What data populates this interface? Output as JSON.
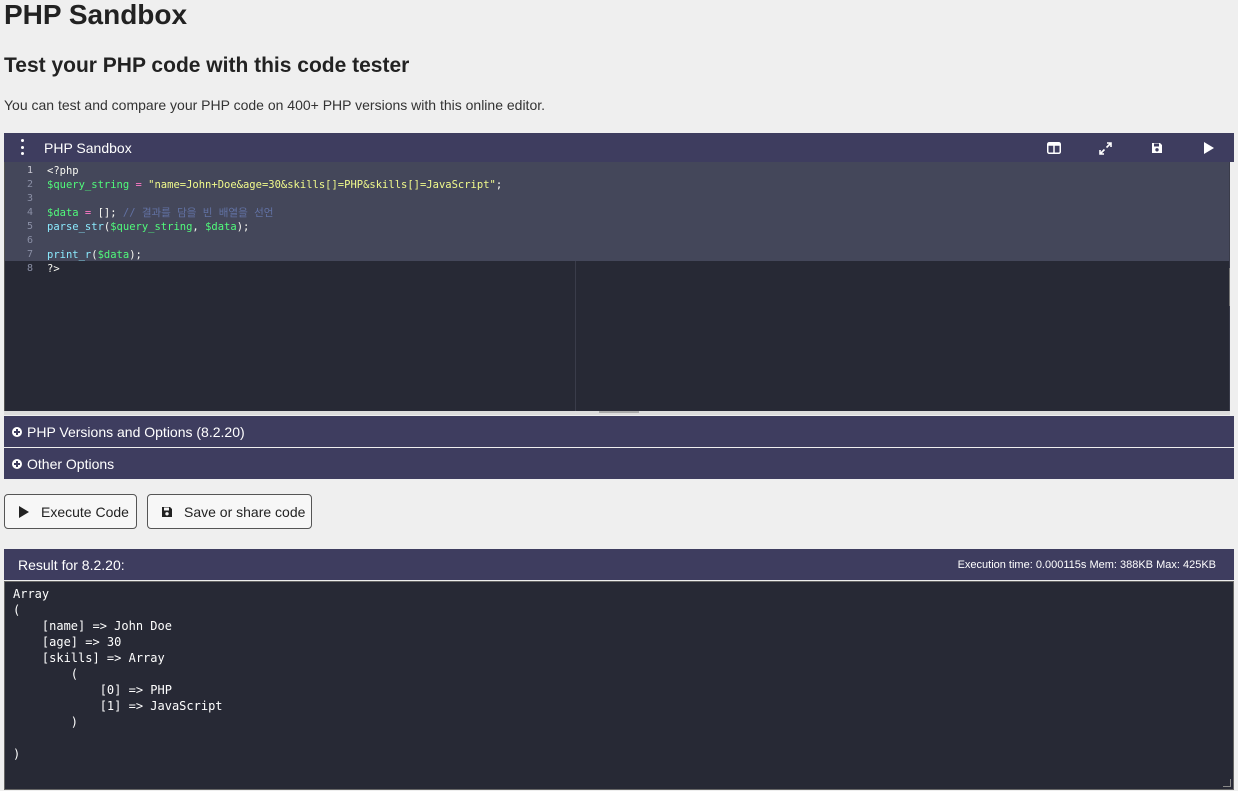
{
  "page": {
    "title": "PHP Sandbox",
    "subtitle": "Test your PHP code with this code tester",
    "description": "You can test and compare your PHP code on 400+ PHP versions with this online editor."
  },
  "editor": {
    "title": "PHP Sandbox",
    "tools": [
      "split-view-icon",
      "expand-icon",
      "save-icon",
      "run-icon"
    ],
    "line_numbers": [
      "1",
      "2",
      "3",
      "4",
      "5",
      "6",
      "7",
      "8"
    ],
    "lines": [
      [
        {
          "t": "<?php",
          "c": "t"
        }
      ],
      [
        {
          "t": "$query_string",
          "c": "v"
        },
        {
          "t": " = ",
          "c": "o"
        },
        {
          "t": "\"name=John+Doe&age=30&skills[]=PHP&skills[]=JavaScript\"",
          "c": "s"
        },
        {
          "t": ";",
          "c": "t"
        }
      ],
      [],
      [
        {
          "t": "$data",
          "c": "v"
        },
        {
          "t": " = ",
          "c": "o"
        },
        {
          "t": "[]; ",
          "c": "t"
        },
        {
          "t": "// 결과를 담을 빈 배열을 선언",
          "c": "c"
        }
      ],
      [
        {
          "t": "parse_str",
          "c": "f"
        },
        {
          "t": "(",
          "c": "t"
        },
        {
          "t": "$query_string",
          "c": "v"
        },
        {
          "t": ", ",
          "c": "t"
        },
        {
          "t": "$data",
          "c": "v"
        },
        {
          "t": ");",
          "c": "t"
        }
      ],
      [],
      [
        {
          "t": "print_r",
          "c": "f"
        },
        {
          "t": "(",
          "c": "t"
        },
        {
          "t": "$data",
          "c": "v"
        },
        {
          "t": ");",
          "c": "t"
        }
      ],
      [
        {
          "t": "?>",
          "c": "t"
        }
      ]
    ]
  },
  "accordions": {
    "versions": "PHP Versions and Options (8.2.20)",
    "other": "Other Options"
  },
  "buttons": {
    "execute": "Execute Code",
    "save": "Save or share code"
  },
  "result": {
    "title": "Result for 8.2.20:",
    "stats": "Execution time: 0.000115s Mem: 388KB Max: 425KB",
    "output": "Array\n(\n    [name] => John Doe\n    [age] => 30\n    [skills] => Array\n        (\n            [0] => PHP\n            [1] => JavaScript\n        )\n\n)"
  },
  "colors": {
    "panel": "#3e3d5f",
    "editor_bg": "#272935",
    "variable": "#50fa7b",
    "string": "#f1fa8c",
    "comment": "#6272a4",
    "function": "#8be9fd"
  }
}
